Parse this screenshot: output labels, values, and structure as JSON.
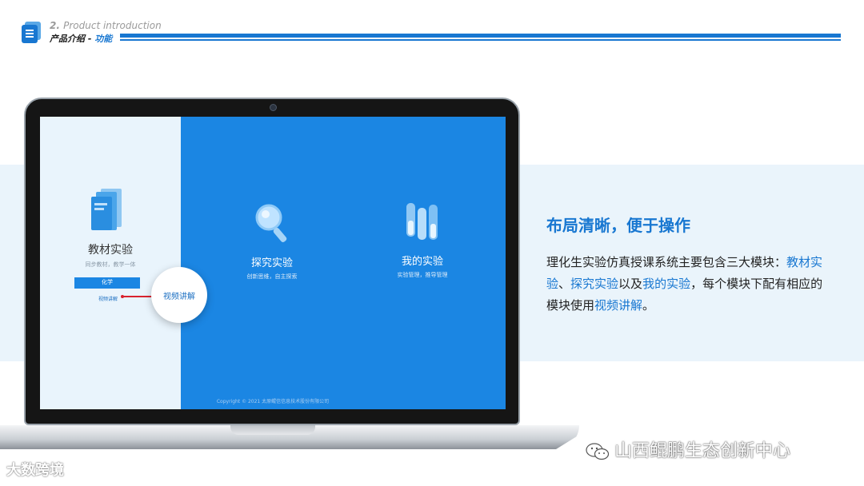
{
  "header": {
    "number": "2.",
    "english": "Product introduction",
    "title_main": "产品介绍",
    "title_sep": " - ",
    "title_accent": "功能"
  },
  "screen": {
    "module1": {
      "title": "教材实验",
      "subtitle": "同步教材，教学一体",
      "button_label": "化学",
      "video_link": "视频讲解"
    },
    "bubble_label": "视频讲解",
    "module2": {
      "title": "探究实验",
      "subtitle": "创新思维，自主探索"
    },
    "module3": {
      "title": "我的实验",
      "subtitle": "实验管理，推导管理"
    },
    "copyright": "Copyright © 2021 太原鲲信信息技术股份有限公司"
  },
  "right": {
    "heading": "布局清晰，便于操作",
    "p1": "理化生实验仿真授课系统主要包含三大模块：",
    "hl1": "教材实验",
    "sep1": "、",
    "hl2": "探究实验",
    "mid": "以及",
    "hl3": "我的实验",
    "p2": "，每个模块下配有相应的模块使用",
    "hl4": "视频讲解",
    "p3": "。"
  },
  "watermarks": {
    "left": "大数跨境",
    "right": "山西鲲鹏生态创新中心"
  },
  "colors": {
    "accent": "#1877d1",
    "screen_blue": "#1b86e3",
    "band": "#eaf4fb",
    "red": "#d9232e"
  }
}
